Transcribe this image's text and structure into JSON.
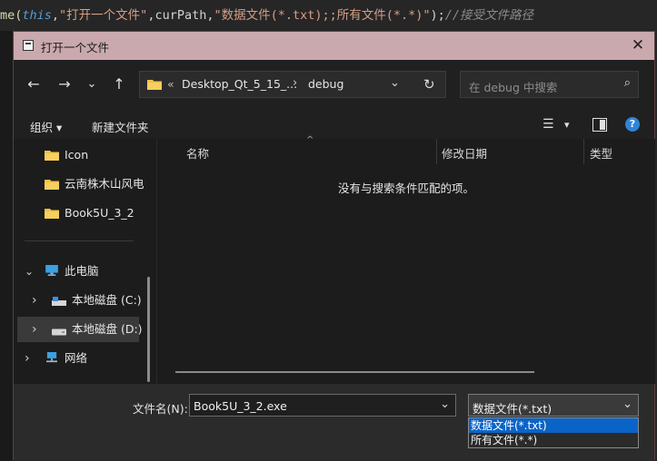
{
  "editor": {
    "code_parts": [
      {
        "text": "me(",
        "cls": "fn"
      },
      {
        "text": "this",
        "cls": "kw"
      },
      {
        "text": ",",
        "cls": ""
      },
      {
        "text": "\"打开一个文件\"",
        "cls": "str"
      },
      {
        "text": ",curPath,",
        "cls": ""
      },
      {
        "text": "\"数据文件(*.txt);;所有文件(*.*)\"",
        "cls": "str"
      },
      {
        "text": ");",
        "cls": ""
      },
      {
        "text": "//接受文件路径",
        "cls": "cm"
      }
    ]
  },
  "dialog": {
    "title": "打开一个文件",
    "close_glyph": "✕"
  },
  "nav": {
    "back": "←",
    "forward": "→",
    "recent": "⌄",
    "up": "↑",
    "address": {
      "overflow": "«",
      "crumb1": "Desktop_Qt_5_15_...",
      "separator": "›",
      "crumb2": "debug",
      "dropdown": "⌄",
      "refresh": "↻"
    },
    "search_placeholder": "在 debug 中搜索",
    "search_icon": "⌕"
  },
  "toolbar": {
    "organize": "组织 ▾",
    "new_folder": "新建文件夹",
    "view_icon": "☰",
    "view_drop": "▾",
    "help": "?"
  },
  "sidebar": {
    "items": [
      {
        "label": "Icon"
      },
      {
        "label": "云南株木山风电"
      },
      {
        "label": "Book5U_3_2"
      }
    ],
    "this_pc": "此电脑",
    "drive_c": "本地磁盘 (C:)",
    "drive_d": "本地磁盘 (D:)",
    "network": "网络",
    "chev_down": "⌄",
    "chev_right": "›"
  },
  "files": {
    "columns": [
      "名称",
      "修改日期",
      "类型"
    ],
    "sort_indicator": "^",
    "empty_message": "没有与搜索条件匹配的项。"
  },
  "bottom": {
    "filename_label": "文件名(N):",
    "filename_value": "Book5U_3_2.exe",
    "filetype_selected": "数据文件(*.txt)",
    "filetype_options": [
      "数据文件(*.txt)",
      "所有文件(*.*)"
    ],
    "dropdown_glyph": "⌄"
  },
  "colors": {
    "titlebar": "#c9a9ad",
    "accent": "#0a64c8",
    "folder": "#f0c04a"
  }
}
